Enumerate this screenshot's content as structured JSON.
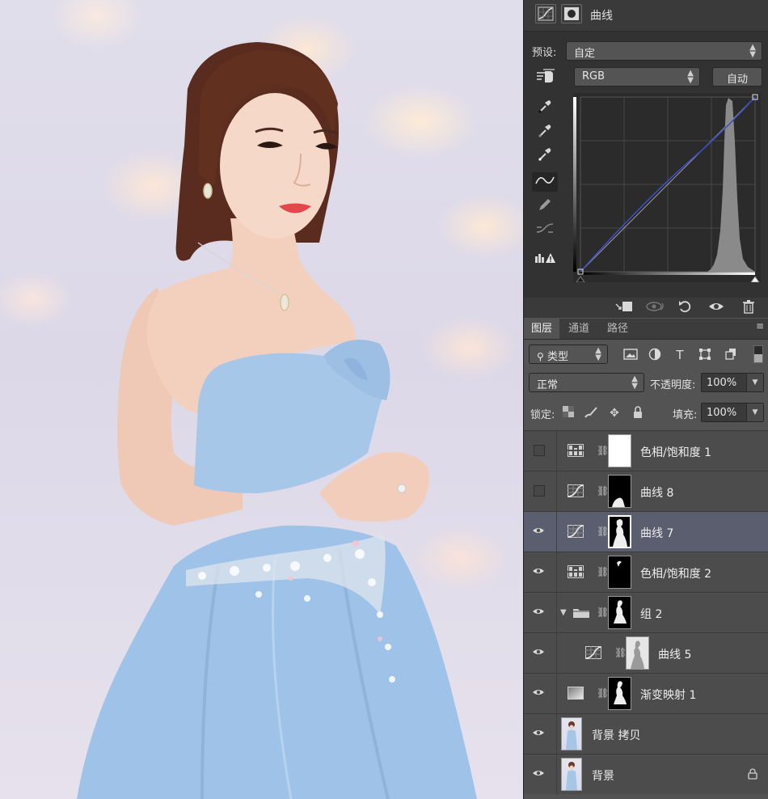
{
  "properties": {
    "title": "曲线",
    "preset_label": "预设:",
    "preset_value": "自定",
    "channel_value": "RGB",
    "auto_button": "自动",
    "tools": [
      "on-image-adjust-icon",
      "eyedropper-black-icon",
      "eyedropper-gray-icon",
      "eyedropper-white-icon",
      "curve-points-icon",
      "pencil-icon",
      "smooth-icon",
      "clipping-warning-icon"
    ],
    "footer_icons": [
      "clip-to-layer-icon",
      "view-previous-icon",
      "reset-icon",
      "visibility-icon",
      "delete-icon"
    ]
  },
  "layers_panel": {
    "tabs": [
      "图层",
      "通道",
      "路径"
    ],
    "active_tab": "图层",
    "filter_kind": "类型",
    "blend_mode": "正常",
    "opacity_label": "不透明度:",
    "opacity_value": "100%",
    "lock_label": "锁定:",
    "fill_label": "填充:",
    "fill_value": "100%",
    "layers": [
      {
        "name": "色相/饱和度 1",
        "visible": false,
        "type": "hue-saturation",
        "mask": "white"
      },
      {
        "name": "曲线 8",
        "visible": false,
        "type": "curves",
        "mask": "black"
      },
      {
        "name": "曲线 7",
        "visible": true,
        "type": "curves",
        "mask": "silhouette",
        "selected": true
      },
      {
        "name": "色相/饱和度 2",
        "visible": true,
        "type": "hue-saturation",
        "mask": "black"
      },
      {
        "name": "组 2",
        "visible": true,
        "type": "group",
        "mask": "silhouette",
        "expanded": true
      },
      {
        "name": "曲线 5",
        "visible": true,
        "type": "curves",
        "mask": "photo",
        "indent": true
      },
      {
        "name": "渐变映射 1",
        "visible": true,
        "type": "gradient-map",
        "mask": "silhouette"
      },
      {
        "name": "背景 拷贝",
        "visible": true,
        "type": "pixel"
      },
      {
        "name": "背景",
        "visible": true,
        "type": "pixel",
        "locked": true
      }
    ]
  }
}
